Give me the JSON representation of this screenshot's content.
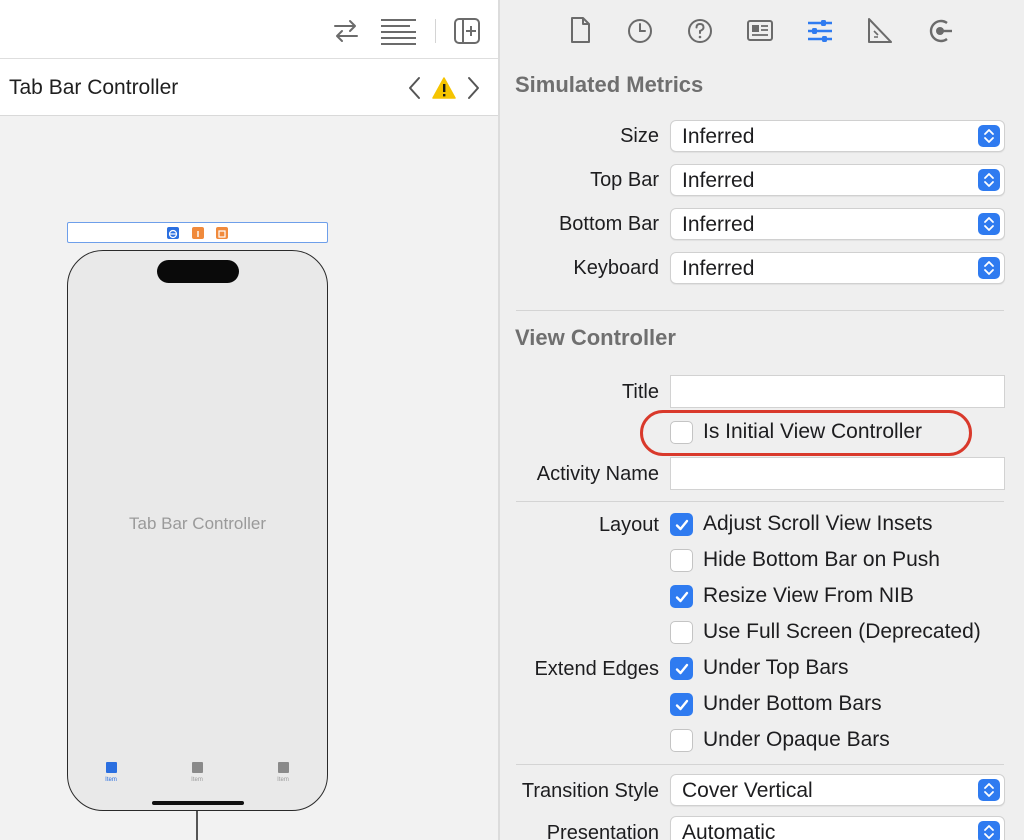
{
  "canvas": {
    "jump_bar_title": "Tab Bar Controller",
    "scene_label": "Tab Bar Controller",
    "tab_items": [
      {
        "label": "Item",
        "selected": true
      },
      {
        "label": "Item",
        "selected": false
      },
      {
        "label": "Item",
        "selected": false
      }
    ],
    "toolbar_icons": [
      "swap-arrows-icon",
      "text-lines-icon",
      "add-editor-icon"
    ],
    "warning_color": "#f5c400"
  },
  "inspector": {
    "tab_icons": [
      "file-icon",
      "history-icon",
      "help-icon",
      "identity-icon",
      "attributes-icon",
      "size-ruler-icon",
      "connections-icon"
    ],
    "active_tab": "attributes-icon",
    "accent_color": "#2f7bf0",
    "simulated_metrics": {
      "title": "Simulated Metrics",
      "size": {
        "label": "Size",
        "value": "Inferred"
      },
      "top_bar": {
        "label": "Top Bar",
        "value": "Inferred"
      },
      "bottom_bar": {
        "label": "Bottom Bar",
        "value": "Inferred"
      },
      "keyboard": {
        "label": "Keyboard",
        "value": "Inferred"
      }
    },
    "view_controller": {
      "title": "View Controller",
      "title_field": {
        "label": "Title",
        "value": ""
      },
      "is_initial": {
        "label": "Is Initial View Controller",
        "checked": false
      },
      "activity_name": {
        "label": "Activity Name",
        "value": ""
      },
      "layout_label": "Layout",
      "layout_options": [
        {
          "label": "Adjust Scroll View Insets",
          "checked": true
        },
        {
          "label": "Hide Bottom Bar on Push",
          "checked": false
        },
        {
          "label": "Resize View From NIB",
          "checked": true
        },
        {
          "label": "Use Full Screen (Deprecated)",
          "checked": false
        }
      ],
      "extend_edges_label": "Extend Edges",
      "extend_edges_options": [
        {
          "label": "Under Top Bars",
          "checked": true
        },
        {
          "label": "Under Bottom Bars",
          "checked": true
        },
        {
          "label": "Under Opaque Bars",
          "checked": false
        }
      ],
      "transition_style": {
        "label": "Transition Style",
        "value": "Cover Vertical"
      },
      "presentation": {
        "label": "Presentation",
        "value": "Automatic"
      }
    },
    "highlight_color": "#d9392b"
  }
}
